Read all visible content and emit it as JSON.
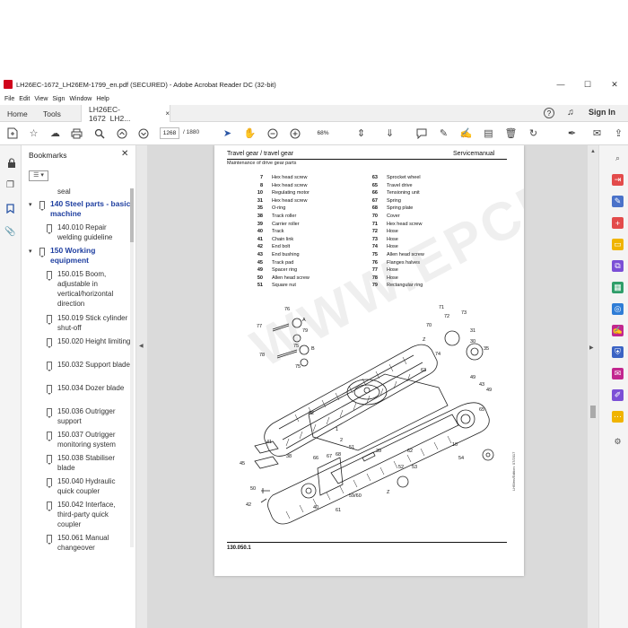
{
  "window": {
    "title": "LH26EC-1672_LH26EM-1799_en.pdf (SECURED) - Adobe Acrobat Reader DC (32-bit)",
    "minimize": "—",
    "maximize": "☐",
    "close": "✕"
  },
  "menu": [
    "File",
    "Edit",
    "View",
    "Sign",
    "Window",
    "Help"
  ],
  "tabs": {
    "home": "Home",
    "tools": "Tools",
    "doc": "LH26EC-1672_LH2...",
    "doc_close": "×",
    "signin": "Sign In"
  },
  "toolbar": {
    "page_current": "1268",
    "page_total": "/ 1880",
    "zoom": "68%"
  },
  "bookmarks": {
    "header": "Bookmarks",
    "close": "✕",
    "options": "☰ ▾",
    "items": [
      {
        "text": "seal",
        "level": 2,
        "strong": false
      },
      {
        "text": "140 Steel parts - basic machine",
        "level": 1,
        "strong": true
      },
      {
        "text": "140.010 Repair welding guideline",
        "level": 2,
        "strong": false
      },
      {
        "text": "150 Working equipment",
        "level": 1,
        "strong": true
      },
      {
        "text": "150.015 Boom, adjustable in vertical/horizontal direction",
        "level": 2,
        "strong": false
      },
      {
        "text": "150.019 Stick cylinder shut-off",
        "level": 2,
        "strong": false
      },
      {
        "text": "150.020 Height limiting",
        "level": 2,
        "strong": false
      },
      {
        "text": "150.032 Support blade",
        "level": 2,
        "strong": false
      },
      {
        "text": "150.034 Dozer blade",
        "level": 2,
        "strong": false
      },
      {
        "text": "150.036 Outrigger support",
        "level": 2,
        "strong": false
      },
      {
        "text": "150.037 Outrigger monitoring system",
        "level": 2,
        "strong": false
      },
      {
        "text": "150.038 Stabiliser blade",
        "level": 2,
        "strong": false
      },
      {
        "text": "150.040 Hydraulic quick coupler",
        "level": 2,
        "strong": false
      },
      {
        "text": "150.042 Interface, third-party quick coupler",
        "level": 2,
        "strong": false
      },
      {
        "text": "150.061 Manual changeover",
        "level": 2,
        "strong": false
      }
    ]
  },
  "page": {
    "header_left": "Travel gear / travel gear",
    "header_right": "Servicemanual",
    "subheader": "Maintenance of drive gear parts",
    "parts_left": [
      {
        "n": "7",
        "name": "Hex head screw"
      },
      {
        "n": "8",
        "name": "Hex head screw"
      },
      {
        "n": "10",
        "name": "Regulating motor"
      },
      {
        "n": "31",
        "name": "Hex head screw"
      },
      {
        "n": "35",
        "name": "O-ring"
      },
      {
        "n": "38",
        "name": "Track roller"
      },
      {
        "n": "39",
        "name": "Carrier roller"
      },
      {
        "n": "40",
        "name": "Track"
      },
      {
        "n": "41",
        "name": "Chain link"
      },
      {
        "n": "42",
        "name": "End bolt"
      },
      {
        "n": "43",
        "name": "End bushing"
      },
      {
        "n": "45",
        "name": "Track pad"
      },
      {
        "n": "49",
        "name": "Spacer ring"
      },
      {
        "n": "50",
        "name": "Allen head screw"
      },
      {
        "n": "51",
        "name": "Square nut"
      }
    ],
    "parts_right": [
      {
        "n": "63",
        "name": "Sprocket wheel"
      },
      {
        "n": "65",
        "name": "Travel drive"
      },
      {
        "n": "66",
        "name": "Tensioning unit"
      },
      {
        "n": "67",
        "name": "Spring"
      },
      {
        "n": "68",
        "name": "Spring plate"
      },
      {
        "n": "70",
        "name": "Cover"
      },
      {
        "n": "71",
        "name": "Hex head screw"
      },
      {
        "n": "72",
        "name": "Hose"
      },
      {
        "n": "73",
        "name": "Hose"
      },
      {
        "n": "74",
        "name": "Hose"
      },
      {
        "n": "75",
        "name": "Allen head screw"
      },
      {
        "n": "76",
        "name": "Flanges halves"
      },
      {
        "n": "77",
        "name": "Hose"
      },
      {
        "n": "78",
        "name": "Hose"
      },
      {
        "n": "79",
        "name": "Rectangular ring"
      }
    ],
    "callouts": [
      "76",
      "A",
      "77",
      "79",
      "75",
      "78",
      "B",
      "75",
      "Z",
      "71",
      "73",
      "72",
      "70",
      "74",
      "31",
      "30",
      "35",
      "63",
      "49",
      "43",
      "49",
      "65",
      "62",
      "1",
      "2",
      "41",
      "45",
      "50",
      "42",
      "38",
      "66",
      "67",
      "68",
      "51",
      "39",
      "40",
      "10",
      "54",
      "59/60",
      "61",
      "62",
      "52",
      "53",
      "Z"
    ],
    "vertical_code": "LHB/en/Edition: 07/2017",
    "footer_code": "130.050.1",
    "watermark": "WWW.EPCDEO.COM"
  }
}
